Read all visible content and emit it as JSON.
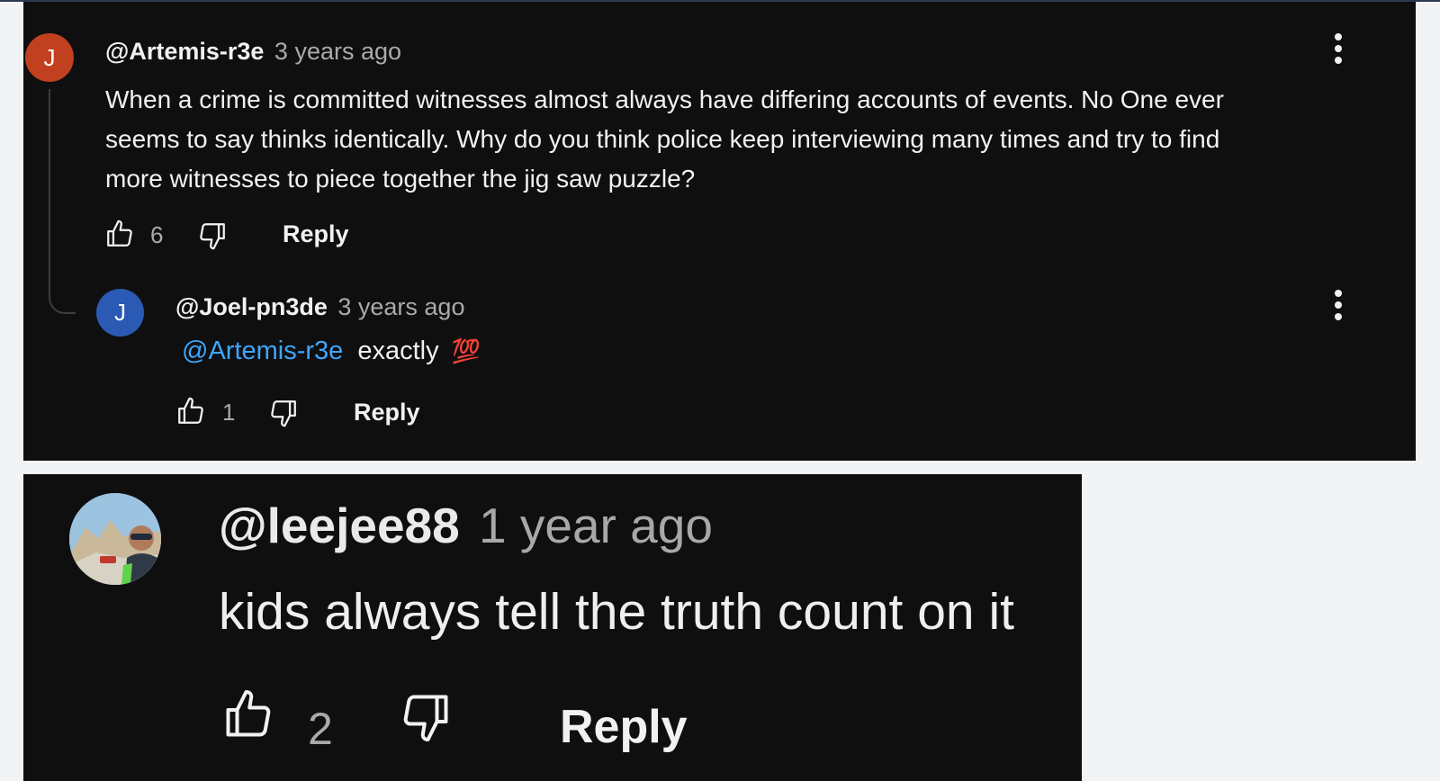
{
  "comments": {
    "top": {
      "avatar_letter": "J",
      "avatar_color": "#c1401f",
      "handle": "@Artemis-r3e",
      "time": "3 years ago",
      "text_lines": [
        "When a crime is committed witnesses almost always have differing accounts of events. No One ever",
        "seems to say thinks identically. Why do you think police keep interviewing many times and try to find",
        "more witnesses to piece together the jig saw puzzle?"
      ],
      "likes": "6",
      "reply_label": "Reply",
      "menu_icon": "more-vert-icon"
    },
    "reply": {
      "avatar_letter": "J",
      "avatar_color": "#2a5ab3",
      "handle": "@Joel-pn3de",
      "time": "3 years ago",
      "mention": "@Artemis-r3e",
      "text": "exactly",
      "emoji": "💯",
      "likes": "1",
      "reply_label": "Reply",
      "menu_icon": "more-vert-icon"
    },
    "second": {
      "handle": "@leejee88",
      "time": "1 year ago",
      "text": "kids always tell the truth count on it",
      "likes": "2",
      "reply_label": "Reply"
    }
  },
  "colors": {
    "background": "#0f0f0f",
    "text": "#f1f1f1",
    "secondary": "#aaaaaa",
    "link": "#3ea6ff"
  }
}
